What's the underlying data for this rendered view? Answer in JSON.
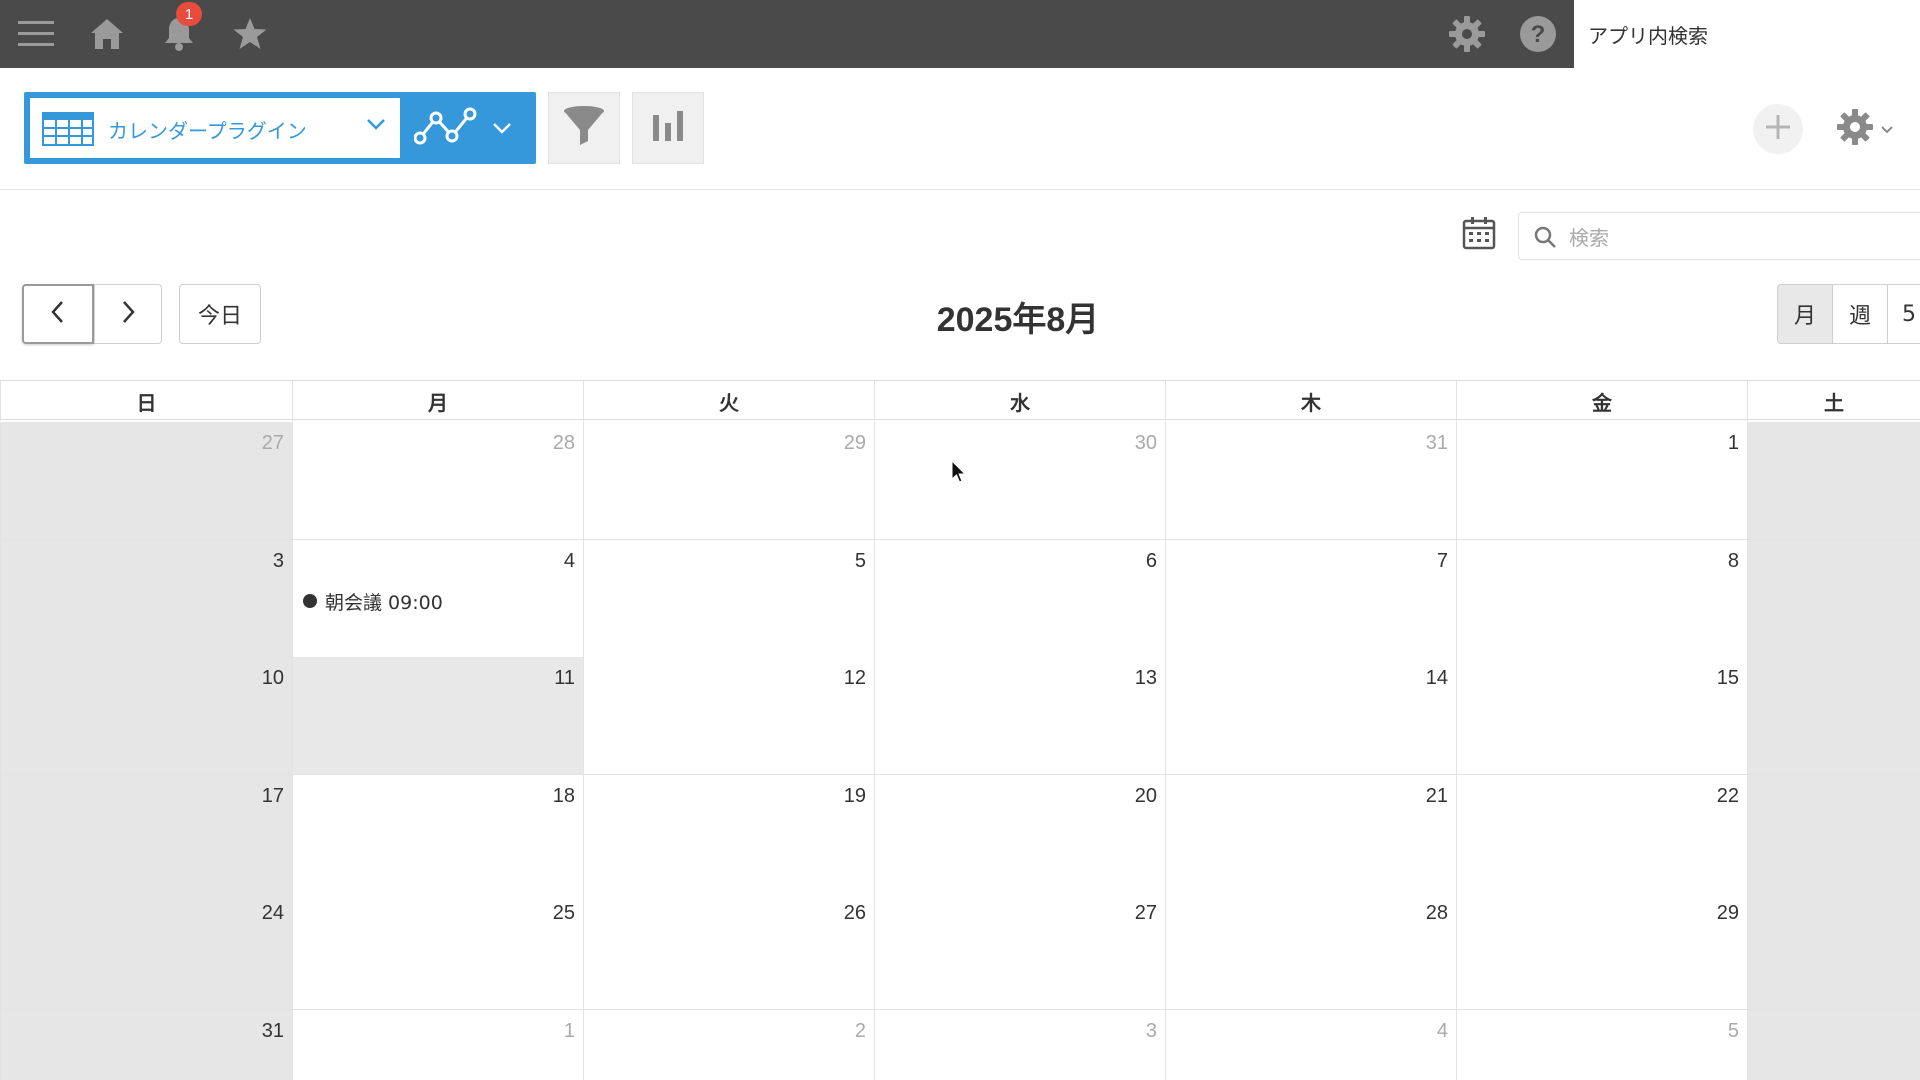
{
  "topbar": {
    "icons": [
      "menu-icon",
      "home-icon",
      "bell-icon",
      "star-icon",
      "gear-icon",
      "help-icon"
    ],
    "notification_count": "1",
    "app_search_placeholder": "アプリ内検索"
  },
  "toolbar": {
    "view_name": "カレンダープラグイン",
    "icons": [
      "table-view-icon",
      "graph-icon",
      "filter-icon",
      "bar-chart-icon",
      "plus-icon",
      "gear-icon"
    ]
  },
  "calendar": {
    "search_placeholder": "検索",
    "today_label": "今日",
    "title": "2025年8月",
    "modes": [
      "月",
      "週",
      "5"
    ],
    "weekdays": [
      "日",
      "月",
      "火",
      "水",
      "木",
      "金",
      "土"
    ],
    "weeks": [
      [
        {
          "d": "27",
          "o": true
        },
        {
          "d": "28",
          "o": true
        },
        {
          "d": "29",
          "o": true
        },
        {
          "d": "30",
          "o": true
        },
        {
          "d": "31",
          "o": true
        },
        {
          "d": "1",
          "o": false
        },
        {
          "d": "",
          "o": false
        }
      ],
      [
        {
          "d": "3",
          "o": false
        },
        {
          "d": "4",
          "o": false
        },
        {
          "d": "5",
          "o": false
        },
        {
          "d": "6",
          "o": false
        },
        {
          "d": "7",
          "o": false
        },
        {
          "d": "8",
          "o": false
        },
        {
          "d": "",
          "o": false
        }
      ],
      [
        {
          "d": "10",
          "o": false
        },
        {
          "d": "11",
          "o": false
        },
        {
          "d": "12",
          "o": false
        },
        {
          "d": "13",
          "o": false
        },
        {
          "d": "14",
          "o": false
        },
        {
          "d": "15",
          "o": false
        },
        {
          "d": "",
          "o": false
        }
      ],
      [
        {
          "d": "17",
          "o": false
        },
        {
          "d": "18",
          "o": false
        },
        {
          "d": "19",
          "o": false
        },
        {
          "d": "20",
          "o": false
        },
        {
          "d": "21",
          "o": false
        },
        {
          "d": "22",
          "o": false
        },
        {
          "d": "",
          "o": false
        }
      ],
      [
        {
          "d": "24",
          "o": false
        },
        {
          "d": "25",
          "o": false
        },
        {
          "d": "26",
          "o": false
        },
        {
          "d": "27",
          "o": false
        },
        {
          "d": "28",
          "o": false
        },
        {
          "d": "29",
          "o": false
        },
        {
          "d": "",
          "o": false
        }
      ],
      [
        {
          "d": "31",
          "o": false
        },
        {
          "d": "1",
          "o": true
        },
        {
          "d": "2",
          "o": true
        },
        {
          "d": "3",
          "o": true
        },
        {
          "d": "4",
          "o": true
        },
        {
          "d": "5",
          "o": true
        },
        {
          "d": "",
          "o": false
        }
      ]
    ],
    "today": {
      "week": 2,
      "day": 1
    },
    "events": [
      {
        "week": 1,
        "day": 1,
        "label": "朝会議 09:00"
      }
    ]
  },
  "colors": {
    "accent": "#3498db",
    "topbar": "#4a4a4a",
    "badge": "#e74c3c",
    "weekend": "#e6e6e6"
  }
}
